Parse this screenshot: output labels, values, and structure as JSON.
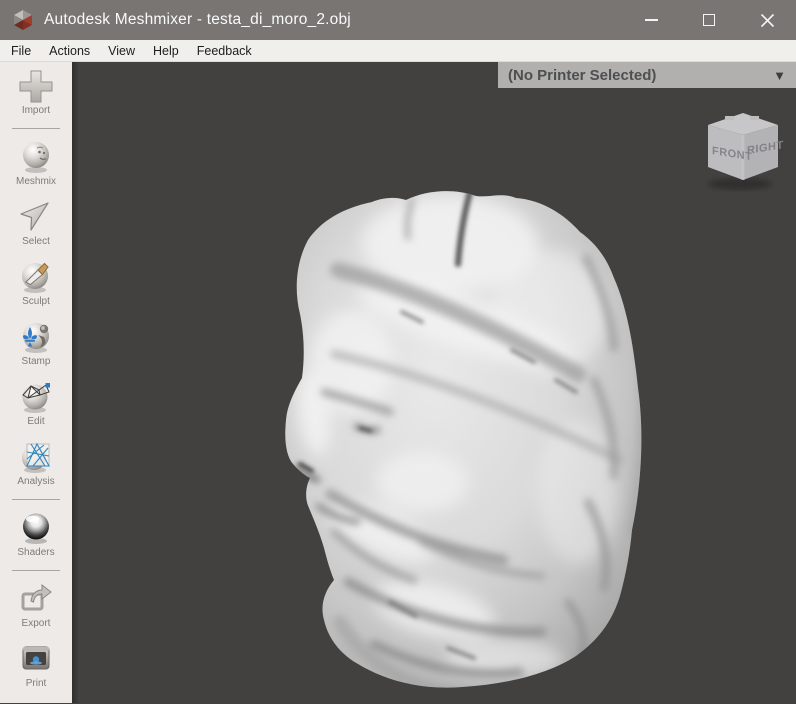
{
  "window": {
    "title": "Autodesk Meshmixer - testa_di_moro_2.obj",
    "controls": [
      "minimize-icon",
      "maximize-icon",
      "close-icon"
    ],
    "logo_icon": "meshmixer-faceted-sphere-logo"
  },
  "menubar": {
    "items": [
      "File",
      "Actions",
      "View",
      "Help",
      "Feedback"
    ]
  },
  "toolbar": {
    "items": [
      {
        "label": "Import",
        "icon": "import-plus-icon"
      },
      {
        "label": "Meshmix",
        "icon": "meshmix-face-sphere-icon"
      },
      {
        "label": "Select",
        "icon": "select-cursor-arrow-icon"
      },
      {
        "label": "Sculpt",
        "icon": "sculpt-brush-sphere-icon"
      },
      {
        "label": "Stamp",
        "icon": "stamp-fleur-de-lis-sphere-icon"
      },
      {
        "label": "Edit",
        "icon": "edit-wireframe-sphere-icon"
      },
      {
        "label": "Analysis",
        "icon": "analysis-mesh-sphere-icon"
      },
      {
        "label": "Shaders",
        "icon": "shaders-chrome-sphere-icon"
      },
      {
        "label": "Export",
        "icon": "export-arrow-icon"
      },
      {
        "label": "Print",
        "icon": "print-3d-printer-icon"
      }
    ]
  },
  "viewport": {
    "printer_selector": {
      "label": "(No Printer Selected)",
      "dropdown_glyph": "▼"
    },
    "view_cube": {
      "front_label": "FRONT",
      "right_label": "RIGHT"
    },
    "model": "sculpted head mesh (testa di moro), gray shaded, facing left"
  },
  "colors": {
    "titlebar_bg": "#787573",
    "menubar_bg": "#f1efec",
    "toolbar_bg": "#edeae7",
    "viewport_bg": "#434140",
    "printer_bar_bg": "#b1b0ae",
    "accent_blue": "#2f7ac9",
    "logo_red": "#a33b2e"
  }
}
